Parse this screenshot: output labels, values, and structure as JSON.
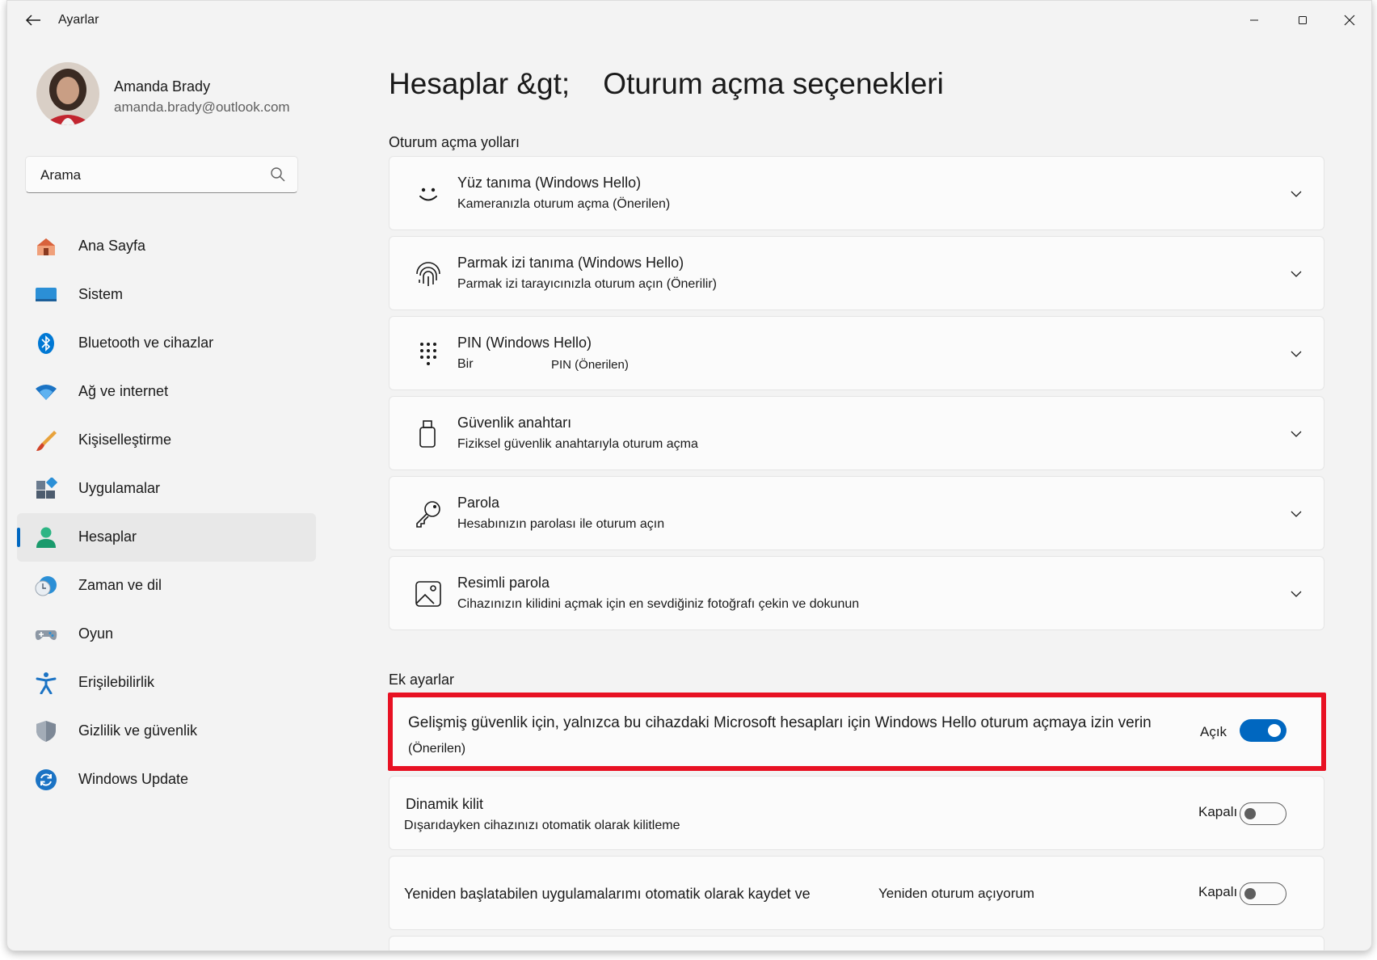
{
  "window": {
    "title": "Ayarlar"
  },
  "profile": {
    "name": "Amanda Brady",
    "email": "amanda.brady@outlook.com"
  },
  "search": {
    "placeholder": "Arama"
  },
  "sidebar": {
    "items": [
      {
        "label": "Ana Sayfa",
        "icon": "home-icon"
      },
      {
        "label": "Sistem",
        "icon": "monitor-icon"
      },
      {
        "label": "Bluetooth ve cihazlar",
        "icon": "bluetooth-icon"
      },
      {
        "label": "Ağ ve internet",
        "icon": "wifi-icon"
      },
      {
        "label": "Kişiselleştirme",
        "icon": "brush-icon"
      },
      {
        "label": "Uygulamalar",
        "icon": "apps-icon"
      },
      {
        "label": "Hesaplar",
        "icon": "person-icon",
        "active": true
      },
      {
        "label": "Zaman ve dil",
        "icon": "clock-globe-icon"
      },
      {
        "label": "Oyun",
        "icon": "gamepad-icon"
      },
      {
        "label": "Erişilebilirlik",
        "icon": "accessibility-icon"
      },
      {
        "label": "Gizlilik ve güvenlik",
        "icon": "shield-icon"
      },
      {
        "label": "Windows Update",
        "icon": "update-icon"
      }
    ]
  },
  "main": {
    "breadcrumb_parent": "Hesaplar &gt;",
    "breadcrumb_current": "Oturum açma seçenekleri",
    "signin_section": "Oturum açma yolları",
    "signin_options": [
      {
        "title": "Yüz tanıma (Windows Hello)",
        "subtitle": "Kameranızla oturum açma (Önerilen)",
        "icon": "face-icon"
      },
      {
        "title": "Parmak izi tanıma (Windows Hello)",
        "subtitle": "Parmak izi tarayıcınızla oturum açın (Önerilir)",
        "icon": "fingerprint-icon"
      },
      {
        "title": "PIN (Windows Hello)",
        "subtitle_a": "Bir",
        "subtitle_b": "PIN (Önerilen)",
        "icon": "keypad-icon"
      },
      {
        "title": "Güvenlik anahtarı",
        "subtitle": "Fiziksel güvenlik anahtarıyla oturum açma",
        "icon": "usb-key-icon"
      },
      {
        "title": "Parola",
        "subtitle": "Hesabınızın parolası ile oturum açın",
        "icon": "key-icon"
      },
      {
        "title": "Resimli parola",
        "subtitle": "Cihazınızın kilidini açmak için en sevdiğiniz fotoğrafı çekin ve dokunun",
        "icon": "picture-icon"
      }
    ],
    "additional_section": "Ek ayarlar",
    "additional": [
      {
        "text": "Gelişmiş güvenlik için, yalnızca bu cihazdaki Microsoft hesapları için Windows Hello oturum açmaya izin verin",
        "subtitle": "(Önerilen)",
        "state_label": "Açık",
        "on": true
      },
      {
        "text": "Dinamik kilit",
        "subtitle": "Dışarıdayken cihazınızı otomatik olarak kilitleme",
        "state_label": "Kapalı",
        "on": false
      },
      {
        "text_a": "Yeniden başlatabilen uygulamalarımı otomatik olarak kaydet ve",
        "text_b": "Yeniden oturum açıyorum",
        "state_label": "Kapalı",
        "on": false
      }
    ]
  },
  "colors": {
    "accent": "#0067c0",
    "highlight": "#e81123",
    "background": "#f3f3f3",
    "card": "#fbfbfb"
  }
}
